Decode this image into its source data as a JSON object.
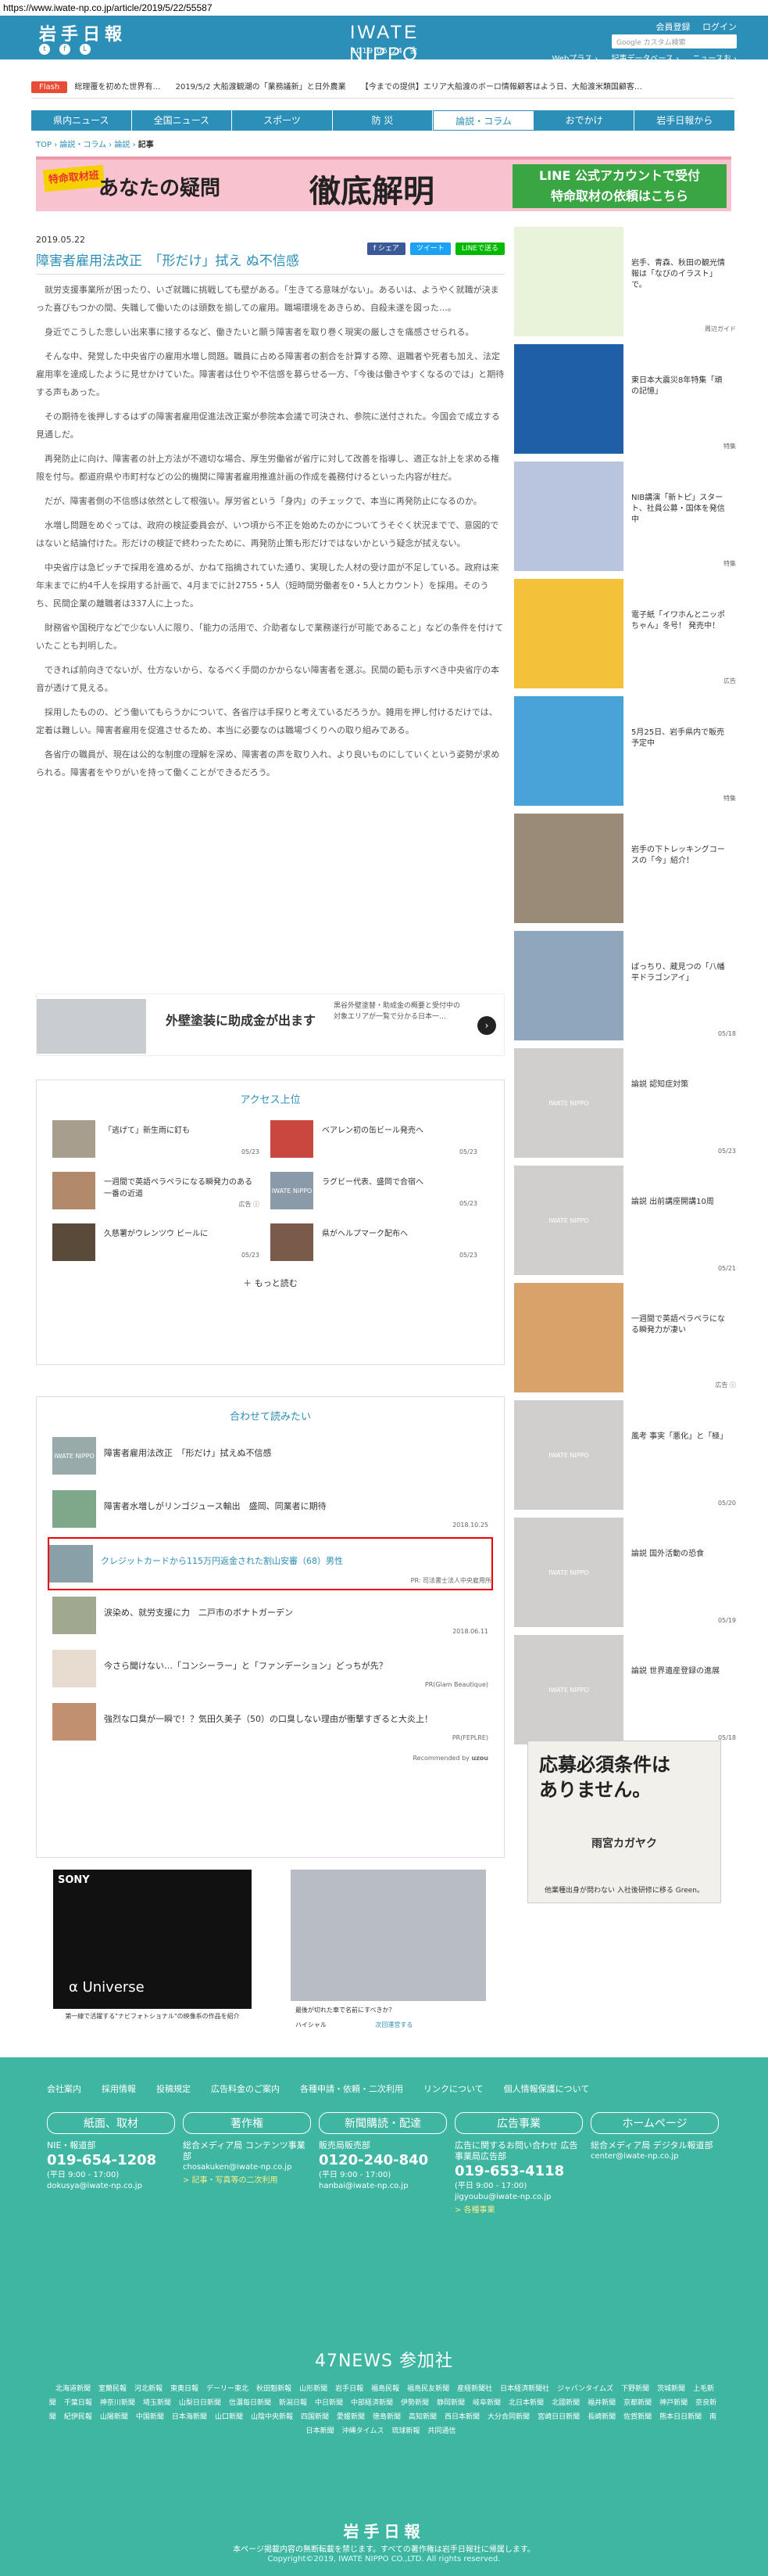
{
  "url": "https://www.iwate-np.co.jp/article/2019/5/22/55587",
  "header": {
    "logo": "岩手日報",
    "site": "IWATE NIPPO",
    "date": "2019.05.24. 金",
    "links": [
      "会員登録",
      "ログイン"
    ],
    "search_placeholder": "Google カスタム検索",
    "sub_links": [
      "Webプラス ›",
      "記事データベース ›",
      "ニュースお ›"
    ]
  },
  "flash": {
    "tag": "Flash",
    "items": [
      "総理覆を初めた世界有…",
      "2019/5/2 大船渡観潮の「業務議新」と日外農業",
      "【今までの提供】エリア大船渡のボーロ情報顧客はよう日、大船渡米類国顧客…"
    ]
  },
  "nav": [
    "県内ニュース",
    "全国ニュース",
    "スポーツ",
    "防 災",
    "論説・コラム",
    "おでかけ",
    "岩手日報から"
  ],
  "breadcrumb": {
    "parts": [
      "TOP",
      "論説・コラム",
      "論説"
    ],
    "current": "記事"
  },
  "banner": {
    "badge": "特命取材班",
    "lead": "あなたの疑問",
    "main": "徹底解明",
    "line1": "LINE 公式アカウントで受付",
    "line2": "特命取材の依頼はこちら"
  },
  "article": {
    "date": "2019.05.22",
    "title": "障害者雇用法改正　「形だけ」拭え ぬ不信感",
    "share": [
      "f シェア",
      "ツイート",
      "LINEで送る"
    ],
    "paragraphs": [
      "就労支援事業所が困ったり、いざ就職に挑戦しても壁がある。「生きてる意味がない」。あるいは、ようやく就職が決まった喜びもつかの間、失職して働いたのは頭数を揃しての雇用。職場環境をあきらめ、自殺未遂を図った…。",
      "身近でこうした悲しい出来事に接するなど、働きたいと願う障害者を取り巻く現実の厳しさを痛感させられる。",
      "そんな中、発覚した中央省庁の雇用水増し問題。職員に占める障害者の割合を計算する際、退職者や死者も加え、法定雇用率を達成したように見せかけていた。障害者は仕りや不信感を募らせる一方、「今後は働きやすくなるのでは」と期待する声もあった。",
      "その期待を後押しするはずの障害者雇用促進法改正案が参院本会議で可決され、参院に送付された。今国会で成立する見通しだ。",
      "再発防止に向け、障害者の計上方法が不適切な場合、厚生労働省が省庁に対して改善を指導し、適正な計上を求める権限を付与。都道府県や市町村などの公的機関に障害者雇用推進計画の作成を義務付けるといった内容が柱だ。",
      "だが、障害者側の不信感は依然として根強い。厚労省という「身内」のチェックで、本当に再発防止になるのか。",
      "水増し問題をめぐっては、政府の検証委員会が、いつ頃から不正を始めたのかについてうそぐく状況までで、意図的ではないと結論付けた。形だけの検証で終わったために、再発防止策も形だけではないかという疑念が拭えない。",
      "中央省庁は急ピッチで採用を進めるが、かねて指摘されていた通り、実現した人材の受け皿が不足している。政府は来年末までに約4千人を採用する計画で、4月までに計2755・5人（短時間労働者を0・5人とカウント）を採用。そのうち、民間企業の離職者は337人に上った。",
      "財務省や国税庁などで少ない人に限り、「能力の活用で、介助者なしで業務遂行が可能であること」などの条件を付けていたことも判明した。",
      "できれば前向きでないが、仕方ないから、なるべく手間のかからない障害者を選ぶ。民間の範も示すべき中央省庁の本音が透けて見える。",
      "採用したものの、どう働いてもらうかについて、各省庁は手探りと考えているだろうか。雑用を押し付けるだけでは、定着は難しい。障害者雇用を促進させるため、本当に必要なのは職場づくりへの取り組みである。",
      "各省庁の職員が、現在は公的な制度の理解を深め、障害者の声を取り入れ、より良いものにしていくという姿勢が求められる。障害者をやりがいを持って働くことができるだろう。"
    ]
  },
  "ad_inline": {
    "title": "外壁塗装に助成金が出ます",
    "sub": "黒谷外壁塗替・助成金の概要と受付中の対象エリアが一覧で分かる日本一…"
  },
  "ranking": {
    "title": "アクセス上位",
    "items": [
      {
        "title": "「逃げて」新生雨に釘も",
        "date": "05/23"
      },
      {
        "title": "ベアレン初の缶ビール発売へ",
        "date": "05/23"
      },
      {
        "title": "一週間で英語ペラペラになる瞬発力のある一番の近道",
        "date": "広告 ⓘ"
      },
      {
        "title": "ラグビー代表、盛岡で合宿へ",
        "date": "05/23"
      },
      {
        "title": "久慈署がウレンツウ ビールに",
        "date": "05/23"
      },
      {
        "title": "県がヘルプマーク配布へ",
        "date": "05/23"
      }
    ],
    "more": "＋ もっと読む"
  },
  "related": {
    "title": "合わせて読みたい",
    "items": [
      {
        "title": "障害者雇用法改正　「形だけ」拭えぬ不信感",
        "date": ""
      },
      {
        "title": "障害者水増しがリンゴジュース輸出　盛岡、同業者に期待",
        "date": "2018.10.25"
      },
      {
        "title": "クレジットカードから115万円返金された割山安審（68）男性",
        "date": "PR: 司法書士法人中央雇用所"
      },
      {
        "title": "涙染め、就労支援に力　二戸市のボナトガーデン",
        "date": "2018.06.11"
      },
      {
        "title": "今さら聞けない…「コンシーラー」と「ファンデーション」どっちが先？",
        "date": "PR(Glam Beautique)"
      },
      {
        "title": "強烈な口臭が一瞬で！？気田久美子（50）の口臭しない理由が衝撃すぎると大炎上！",
        "date": "PR(FEPLRE)"
      }
    ],
    "reco": "Recommended by ",
    "reco_brand": "uzou"
  },
  "sony_ad": {
    "brand": "SONY",
    "line": "α Universe",
    "caption": "第一線で活躍する\"ナビフォトショナル\"の映像系の作品を紹介"
  },
  "car_ad": {
    "caption": "最後が切れた車で名前にすべきか？",
    "brand": "ハイシャル",
    "credit": "次回運営する"
  },
  "sidebar": [
    {
      "title": "岩手、青森、秋田の観光情報は「なびのイラスト」で。",
      "label": "周辺ガイド"
    },
    {
      "title": "東日本大震災8年特集「頑の記憶」",
      "label": "特集"
    },
    {
      "title": "NIB講演「新トピ」スタート、社員公募・国体を発信中",
      "label": "特集"
    },
    {
      "title": "電子紙「イワホんとニッポちゃん」冬号！ 発売中！",
      "label": "広告"
    },
    {
      "title": "5月25日、岩手県内で販売予定中",
      "label": "特集"
    },
    {
      "title": "岩手の下トレッキングコースの「今」紹介！",
      "label": ""
    },
    {
      "title": "ぱっちり、蔵見つの「八幡平ドラゴンアイ」",
      "label": "05/18"
    },
    {
      "title": "論説 認知症対策",
      "label": "05/23"
    },
    {
      "title": "論説 出前講座開講10周",
      "label": "05/21"
    },
    {
      "title": "一週間で英語ペラペラになる瞬発力が凄い",
      "label": "広告 ⓘ"
    },
    {
      "title": "風考 事実「悪化」と「極」",
      "label": "05/20"
    },
    {
      "title": "論説 国外活動の恐食",
      "label": "05/19"
    },
    {
      "title": "論説 世界遺産登録の進展",
      "label": "05/18"
    }
  ],
  "side_ad": {
    "line1": "応募必須条件は",
    "line2": "ありません。",
    "brand": "雨宮カガヤク",
    "sub": "他業種出身が問わない 入社後研修に移る Green。"
  },
  "footer": {
    "links": [
      "会社案内",
      "採用情報",
      "投稿規定",
      "広告料金のご案内",
      "各種申請・依頼・二次利用",
      "リンクについて",
      "個人情報保護について"
    ],
    "cols": [
      {
        "head": "紙面、取材",
        "label": "NIE・報道部",
        "phone": "019-654-1208",
        "hours": "(平日 9:00 - 17:00)",
        "mail": "dokusya@iwate-np.co.jp",
        "note": ""
      },
      {
        "head": "著作権",
        "label": "総合メディア局 コンテンツ事業部",
        "phone": "",
        "hours": "",
        "mail": "chosakuken@iwate-np.co.jp",
        "note": "> 記事・写真等の二次利用"
      },
      {
        "head": "新聞購読・配達",
        "label": "販売局販売部",
        "phone": "0120-240-840",
        "hours": "(平日 9:00 - 17:00)",
        "mail": "hanbai@iwate-np.co.jp",
        "note": ""
      },
      {
        "head": "広告事業",
        "label": "広告に関するお問い合わせ 広告事業局広告部",
        "phone": "019-653-4118",
        "hours": "(平日 9:00 - 17:00)",
        "mail": "jigyoubu@iwate-np.co.jp",
        "note": "> 各種事業"
      },
      {
        "head": "ホームページ",
        "label": "総合メディア局 デジタル報道部",
        "phone": "",
        "hours": "",
        "mail": "center@iwate-np.co.jp",
        "note": ""
      }
    ],
    "n47": "47NEWS 参加社",
    "papers": [
      "北海道新聞",
      "室蘭民報",
      "河北新報",
      "東奥日報",
      "デーリー東北",
      "秋田魁新報",
      "山形新聞",
      "岩手日報",
      "福島民報",
      "福島民友新聞",
      "産経新聞社",
      "日本経済新聞社",
      "ジャパンタイムズ",
      "下野新聞",
      "茨城新聞",
      "上毛新聞",
      "千葉日報",
      "神奈川新聞",
      "埼玉新聞",
      "山梨日日新聞",
      "信濃毎日新聞",
      "新潟日報",
      "中日新聞",
      "中部経済新聞",
      "伊勢新聞",
      "静岡新聞",
      "岐阜新聞",
      "北日本新聞",
      "北國新聞",
      "福井新聞",
      "京都新聞",
      "神戸新聞",
      "奈良新聞",
      "紀伊民報",
      "山陽新聞",
      "中国新聞",
      "日本海新聞",
      "山口新聞",
      "山陰中央新報",
      "四国新聞",
      "愛媛新聞",
      "徳島新聞",
      "高知新聞",
      "西日本新聞",
      "大分合同新聞",
      "宮崎日日新聞",
      "長崎新聞",
      "佐賀新聞",
      "熊本日日新聞",
      "南日本新聞",
      "沖縄タイムス",
      "琉球新報",
      "共同通信"
    ],
    "logo": "岩手日報",
    "copy": "本ページ掲載内容の無断転載を禁じます。すべての著作権は岩手日報社に帰属します。",
    "copy2": "Copyright©2019, IWATE NIPPO CO.,LTD. All rights reserved."
  },
  "colors": {
    "brand": "#2c8fb7",
    "footer": "#3fb6a2",
    "flash": "#e94b35",
    "highlight": "#e00000"
  }
}
